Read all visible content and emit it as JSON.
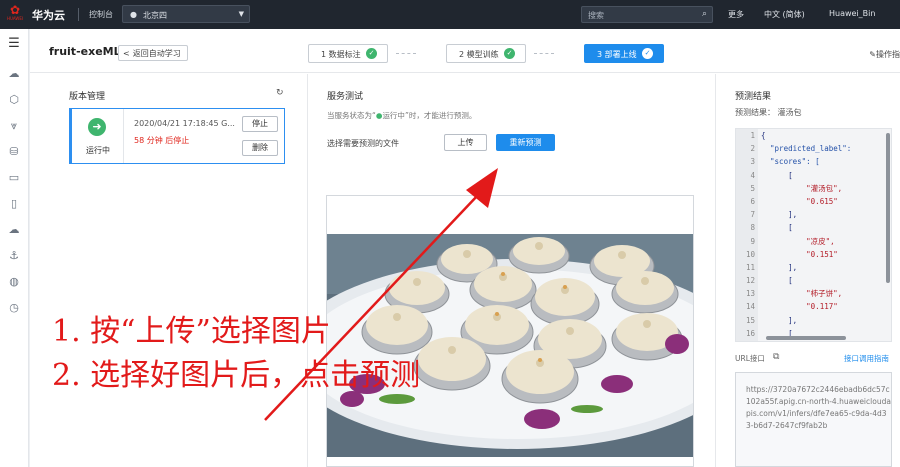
{
  "topbar": {
    "logo_text": "HUAWEI",
    "brand": "华为云",
    "console": "控制台",
    "region": "北京四",
    "search_placeholder": "搜索",
    "more": "更多",
    "language": "中文 (简体)",
    "user": "Huawei_Bin"
  },
  "sidebar_icons": [
    "menu-icon",
    "cloud-icon",
    "cluster-icon",
    "model-icon",
    "storage-icon",
    "doc-icon",
    "file-icon",
    "cloud-service-icon",
    "anchor-icon",
    "globe-icon",
    "clock-icon"
  ],
  "header": {
    "title": "fruit-exeML",
    "back_label": "返回自动学习",
    "steps": [
      {
        "label": "1 数据标注",
        "done": true,
        "active": false
      },
      {
        "label": "2 模型训练",
        "done": true,
        "active": false
      },
      {
        "label": "3 部署上线",
        "done": true,
        "active": true
      }
    ],
    "op_label": "操作指"
  },
  "version": {
    "title": "版本管理",
    "status": "运行中",
    "time": "2020/04/21 17:18:45 G...",
    "warning": "58 分钟 后停止",
    "stop": "停止",
    "delete": "删除"
  },
  "service": {
    "title": "服务测试",
    "tip_prefix": "当服务状态为“",
    "tip_status": "运行中",
    "tip_suffix": "”时，才能进行预测。",
    "pick_label": "选择需要预测的文件",
    "upload": "上传",
    "predict": "重新预测"
  },
  "result": {
    "title": "预测结果",
    "label": "预测结果：  灌汤包",
    "line_numbers": [
      "1",
      "2",
      "3",
      "4",
      "5",
      "6",
      "7",
      "8",
      "9",
      "10",
      "11",
      "12",
      "13",
      "14",
      "15",
      "16"
    ],
    "code_lines": [
      {
        "t": "{",
        "c": "p"
      },
      {
        "t": "  \"predicted_label\":",
        "c": "k"
      },
      {
        "t": "  \"scores\": [",
        "c": "k"
      },
      {
        "t": "      [",
        "c": "p"
      },
      {
        "t": "          \"灌汤包\",",
        "c": "s"
      },
      {
        "t": "          \"0.615\"",
        "c": "s"
      },
      {
        "t": "      ],",
        "c": "p"
      },
      {
        "t": "      [",
        "c": "p"
      },
      {
        "t": "          \"凉皮\",",
        "c": "s"
      },
      {
        "t": "          \"0.151\"",
        "c": "s"
      },
      {
        "t": "      ],",
        "c": "p"
      },
      {
        "t": "      [",
        "c": "p"
      },
      {
        "t": "          \"柿子饼\",",
        "c": "s"
      },
      {
        "t": "          \"0.117\"",
        "c": "s"
      },
      {
        "t": "      ],",
        "c": "p"
      },
      {
        "t": "      [",
        "c": "p"
      }
    ],
    "url_label": "URL接口",
    "api_link": "接口调用指南",
    "url": "https://3720a7672c2446ebadb6dc57c102a55f.apig.cn-north-4.huaweicloudapis.com/v1/infers/dfe7ea65-c9da-4d33-b6d7-2647cf9fab2b"
  },
  "annotations": {
    "line1": "1. 按“上传”选择图片",
    "line2": "2. 选择好图片后，点击预测"
  },
  "colors": {
    "accent": "#1e8cec",
    "success": "#3fb56e",
    "annotation": "#e21a1a",
    "topbar": "#20262f"
  }
}
